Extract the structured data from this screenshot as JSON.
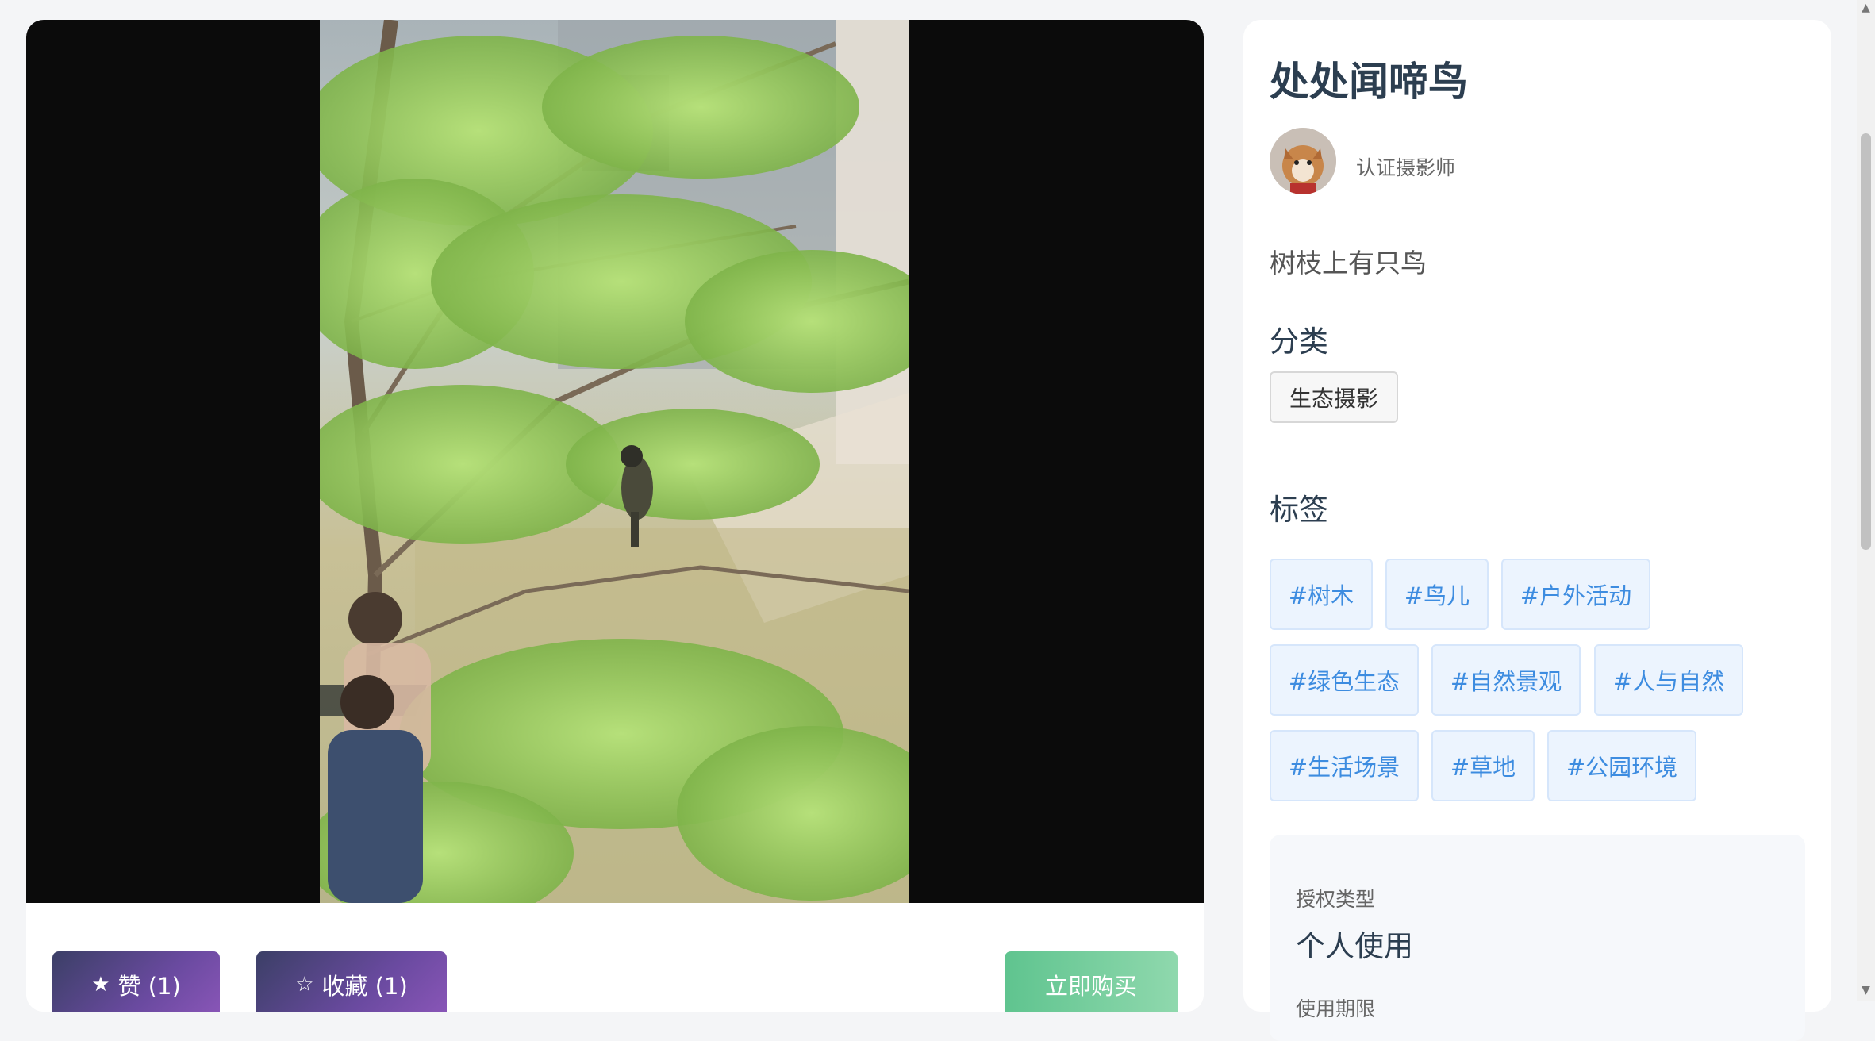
{
  "artwork": {
    "title": "处处闻啼鸟",
    "description": "树枝上有只鸟",
    "photo_subject": "tree-branch-with-bird"
  },
  "author": {
    "role": "认证摄影师",
    "avatar_icon": "dog-avatar"
  },
  "category": {
    "heading": "分类",
    "value": "生态摄影"
  },
  "tags": {
    "heading": "标签",
    "items": [
      "#树木",
      "#鸟儿",
      "#户外活动",
      "#绿色生态",
      "#自然景观",
      "#人与自然",
      "#生活场景",
      "#草地",
      "#公园环境"
    ]
  },
  "license": {
    "type_label": "授权类型",
    "type_value": "个人使用",
    "period_label": "使用期限"
  },
  "actions": {
    "like_label": "赞 (1)",
    "favorite_label": "收藏 (1)",
    "buy_label": "立即购买",
    "like_icon": "star-filled-icon",
    "favorite_icon": "star-outline-icon"
  },
  "colors": {
    "primary_gradient": "#6a4aa0",
    "buy_green": "#5fc48f",
    "tag_blue": "#3d8ce0"
  }
}
